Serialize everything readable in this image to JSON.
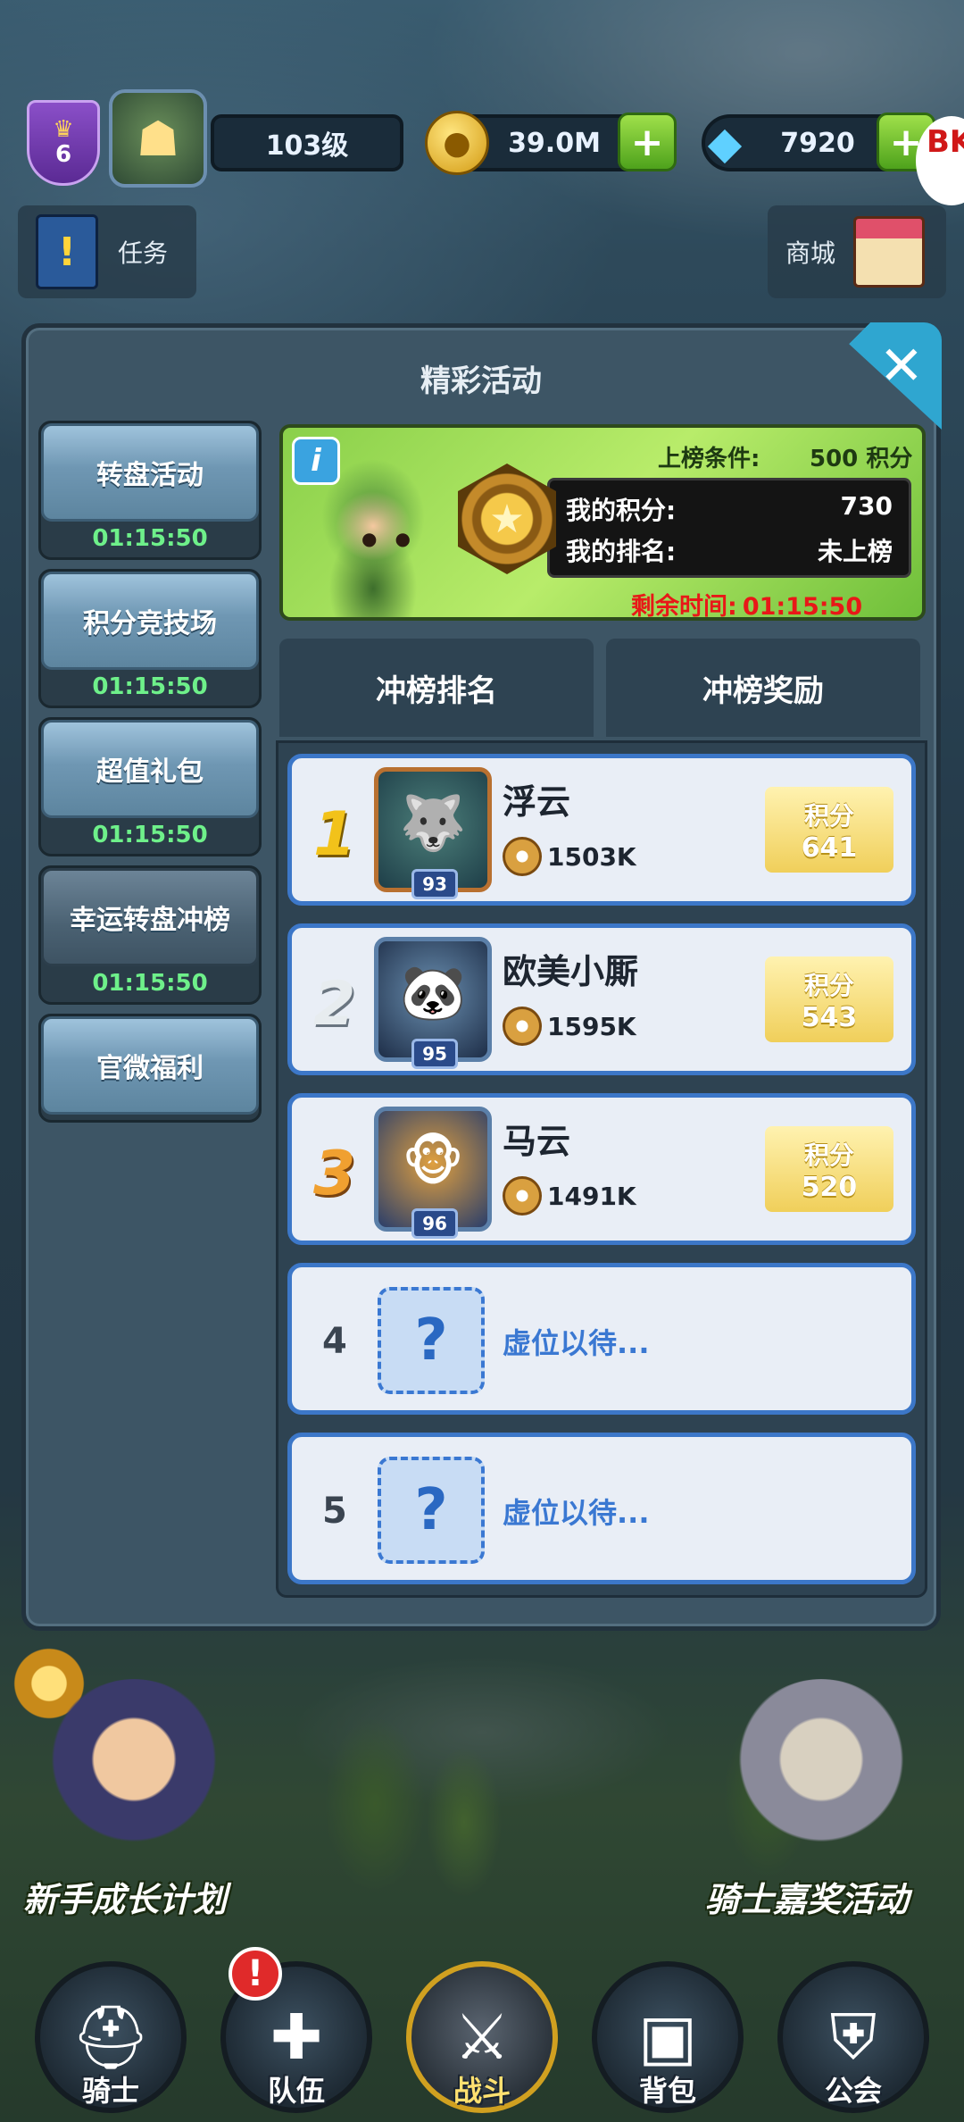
{
  "top_bar": {
    "vip_level": "6",
    "player_level": "103级",
    "coins": "39.0M",
    "gems": "7920",
    "plus_label": "+",
    "logo_text": "BK"
  },
  "quick_buttons": {
    "task_label": "任务",
    "shop_label": "商城"
  },
  "panel": {
    "title": "精彩活动",
    "close_label": "✕"
  },
  "sidebar": {
    "items": [
      {
        "label": "转盘活动",
        "time": "01:15:50",
        "active": false
      },
      {
        "label": "积分竞技场",
        "time": "01:15:50",
        "active": false
      },
      {
        "label": "超值礼包",
        "time": "01:15:50",
        "active": false
      },
      {
        "label": "幸运转盘冲榜",
        "time": "01:15:50",
        "active": true
      },
      {
        "label": "官微福利",
        "time": "",
        "active": false
      }
    ]
  },
  "banner": {
    "info_label": "i",
    "condition_label": "上榜条件:",
    "condition_value": "500 积分",
    "my_points_label": "我的积分:",
    "my_points_value": "730",
    "my_rank_label": "我的排名:",
    "my_rank_value": "未上榜",
    "remaining_label": "剩余时间:",
    "remaining_value": "01:15:50"
  },
  "tabs": {
    "ranking": "冲榜排名",
    "rewards": "冲榜奖励"
  },
  "ranking": {
    "points_label": "积分",
    "rows": [
      {
        "rank": "1",
        "name": "浮云",
        "level": "93",
        "power": "1503K",
        "points": "641"
      },
      {
        "rank": "2",
        "name": "欧美小厮",
        "level": "95",
        "power": "1595K",
        "points": "543"
      },
      {
        "rank": "3",
        "name": "马云",
        "level": "96",
        "power": "1491K",
        "points": "520"
      }
    ],
    "empty_rows": [
      {
        "rank": "4",
        "text": "虚位以待..."
      },
      {
        "rank": "5",
        "text": "虚位以待..."
      }
    ],
    "empty_mark": "?"
  },
  "promos": {
    "left": "新手成长计划",
    "right": "骑士嘉奖活动"
  },
  "bottom_nav": {
    "items": [
      {
        "label": "骑士",
        "icon": "helmet-icon"
      },
      {
        "label": "队伍",
        "icon": "team-shield-icon"
      },
      {
        "label": "战斗",
        "icon": "crossed-swords-icon"
      },
      {
        "label": "背包",
        "icon": "backpack-icon"
      },
      {
        "label": "公会",
        "icon": "guild-icon"
      }
    ],
    "alert_mark": "!"
  }
}
